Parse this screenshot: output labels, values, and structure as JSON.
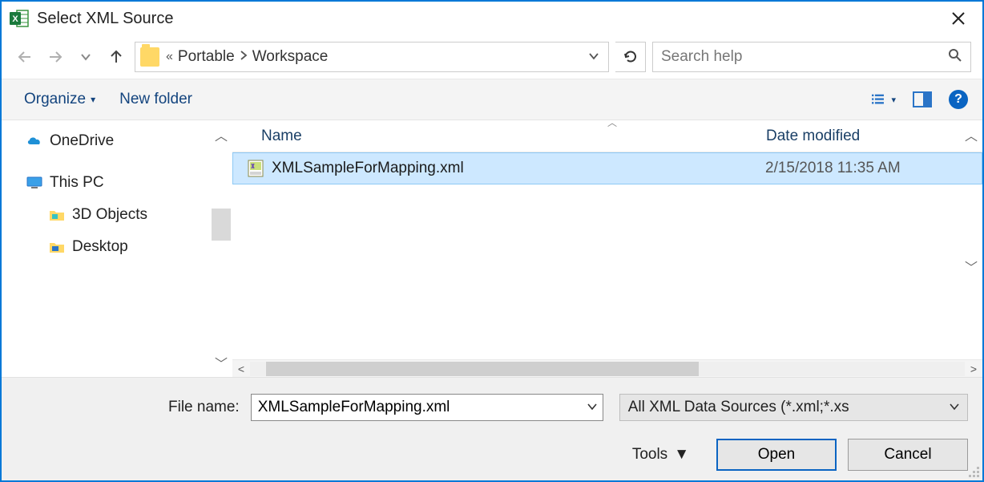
{
  "title": "Select XML Source",
  "breadcrumb": {
    "prefix": "«",
    "part1": "Portable",
    "part2": "Workspace"
  },
  "search": {
    "placeholder": "Search help"
  },
  "toolbar": {
    "organize": "Organize",
    "newfolder": "New folder"
  },
  "tree": {
    "items": [
      {
        "label": "OneDrive",
        "icon": "cloud"
      },
      {
        "label": "This PC",
        "icon": "pc"
      },
      {
        "label": "3D Objects",
        "icon": "folder3d",
        "indent": true
      },
      {
        "label": "Desktop",
        "icon": "folderdesk",
        "indent": true
      }
    ]
  },
  "columns": {
    "name": "Name",
    "date": "Date modified"
  },
  "files": [
    {
      "name": "XMLSampleForMapping.xml",
      "date": "2/15/2018 11:35 AM",
      "selected": true
    }
  ],
  "footer": {
    "filename_label": "File name:",
    "filename_value": "XMLSampleForMapping.xml",
    "filter_text": "All XML Data Sources (*.xml;*.xs",
    "tools": "Tools",
    "open": "Open",
    "cancel": "Cancel"
  }
}
